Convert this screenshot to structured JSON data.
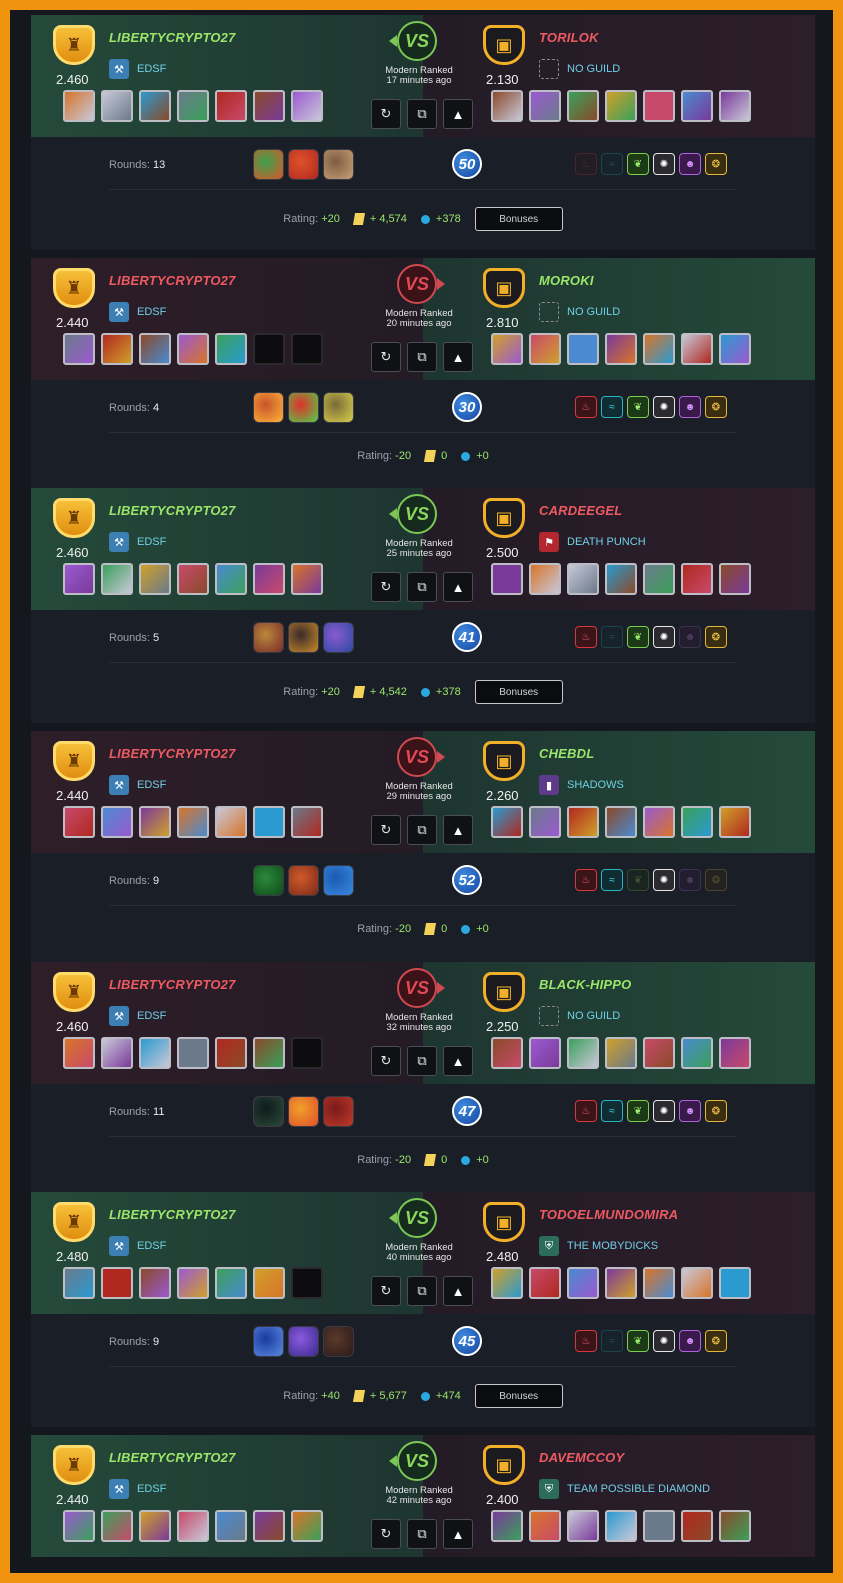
{
  "battles": [
    {
      "result": "win",
      "left": {
        "name": "LIBERTYCRYPTO27",
        "rating": "2.460",
        "guild": "EDSF",
        "guild_icon": "blue",
        "name_class": "win",
        "cards": 7,
        "empty": 0
      },
      "right": {
        "name": "TORILOK",
        "rating": "2.130",
        "guild": "NO GUILD",
        "guild_icon": "none",
        "name_class": "loss",
        "cards": 7,
        "empty": 0
      },
      "mode": "Modern Ranked",
      "time": "17 minutes ago",
      "rounds_label": "Rounds:",
      "rounds": "13",
      "mana": "50",
      "splinters": [
        false,
        false,
        true,
        true,
        true,
        true
      ],
      "rating_label": "Rating:",
      "rating_change": "+20",
      "dec": "+ 4,574",
      "sps": "+378",
      "bonuses": "Bonuses"
    },
    {
      "result": "loss",
      "left": {
        "name": "LIBERTYCRYPTO27",
        "rating": "2.440",
        "guild": "EDSF",
        "guild_icon": "blue",
        "name_class": "loss",
        "cards": 5,
        "empty": 2
      },
      "right": {
        "name": "MOROKI",
        "rating": "2.810",
        "guild": "NO GUILD",
        "guild_icon": "none",
        "name_class": "win",
        "cards": 7,
        "empty": 0
      },
      "mode": "Modern Ranked",
      "time": "20 minutes ago",
      "rounds_label": "Rounds:",
      "rounds": "4",
      "mana": "30",
      "splinters": [
        true,
        true,
        true,
        true,
        true,
        true
      ],
      "rating_label": "Rating:",
      "rating_change": "-20",
      "dec": "0",
      "sps": "+0",
      "bonuses": ""
    },
    {
      "result": "win",
      "left": {
        "name": "LIBERTYCRYPTO27",
        "rating": "2.460",
        "guild": "EDSF",
        "guild_icon": "blue",
        "name_class": "win",
        "cards": 7,
        "empty": 0
      },
      "right": {
        "name": "CARDEEGEL",
        "rating": "2.500",
        "guild": "DEATH PUNCH",
        "guild_icon": "red",
        "name_class": "loss",
        "cards": 7,
        "empty": 0
      },
      "mode": "Modern Ranked",
      "time": "25 minutes ago",
      "rounds_label": "Rounds:",
      "rounds": "5",
      "mana": "41",
      "splinters": [
        true,
        false,
        true,
        true,
        false,
        true
      ],
      "rating_label": "Rating:",
      "rating_change": "+20",
      "dec": "+ 4,542",
      "sps": "+378",
      "bonuses": "Bonuses"
    },
    {
      "result": "loss",
      "left": {
        "name": "LIBERTYCRYPTO27",
        "rating": "2.440",
        "guild": "EDSF",
        "guild_icon": "blue",
        "name_class": "loss",
        "cards": 7,
        "empty": 0
      },
      "right": {
        "name": "CHEBDL",
        "rating": "2.260",
        "guild": "SHADOWS",
        "guild_icon": "purple",
        "name_class": "win",
        "cards": 7,
        "empty": 0
      },
      "mode": "Modern Ranked",
      "time": "29 minutes ago",
      "rounds_label": "Rounds:",
      "rounds": "9",
      "mana": "52",
      "splinters": [
        true,
        true,
        false,
        true,
        false,
        false
      ],
      "rating_label": "Rating:",
      "rating_change": "-20",
      "dec": "0",
      "sps": "+0",
      "bonuses": ""
    },
    {
      "result": "loss",
      "left": {
        "name": "LIBERTYCRYPTO27",
        "rating": "2.460",
        "guild": "EDSF",
        "guild_icon": "blue",
        "name_class": "loss",
        "cards": 6,
        "empty": 1
      },
      "right": {
        "name": "BLACK-HIPPO",
        "rating": "2.250",
        "guild": "NO GUILD",
        "guild_icon": "none",
        "name_class": "win",
        "cards": 7,
        "empty": 0
      },
      "mode": "Modern Ranked",
      "time": "32 minutes ago",
      "rounds_label": "Rounds:",
      "rounds": "11",
      "mana": "47",
      "splinters": [
        true,
        true,
        true,
        true,
        true,
        true
      ],
      "rating_label": "Rating:",
      "rating_change": "-20",
      "dec": "0",
      "sps": "+0",
      "bonuses": ""
    },
    {
      "result": "win",
      "left": {
        "name": "LIBERTYCRYPTO27",
        "rating": "2.480",
        "guild": "EDSF",
        "guild_icon": "blue",
        "name_class": "win",
        "cards": 6,
        "empty": 1
      },
      "right": {
        "name": "TODOELMUNDOMIRA",
        "rating": "2.480",
        "guild": "THE MOBYDICKS",
        "guild_icon": "green",
        "name_class": "loss",
        "cards": 7,
        "empty": 0
      },
      "mode": "Modern Ranked",
      "time": "40 minutes ago",
      "rounds_label": "Rounds:",
      "rounds": "9",
      "mana": "45",
      "splinters": [
        true,
        false,
        true,
        true,
        true,
        true
      ],
      "rating_label": "Rating:",
      "rating_change": "+40",
      "dec": "+ 5,677",
      "sps": "+474",
      "bonuses": "Bonuses"
    },
    {
      "result": "win",
      "left": {
        "name": "LIBERTYCRYPTO27",
        "rating": "2.440",
        "guild": "EDSF",
        "guild_icon": "blue",
        "name_class": "win",
        "cards": 7,
        "empty": 0
      },
      "right": {
        "name": "DAVEMCCOY",
        "rating": "2.400",
        "guild": "TEAM POSSIBLE DIAMOND",
        "guild_icon": "green",
        "name_class": "loss",
        "cards": 7,
        "empty": 0
      },
      "mode": "Modern Ranked",
      "time": "42 minutes ago",
      "rounds_label": "",
      "rounds": "",
      "mana": "",
      "splinters": [],
      "rating_label": "",
      "rating_change": "",
      "dec": "",
      "sps": "",
      "bonuses": ""
    }
  ],
  "icons": {
    "replay": "↻",
    "copy": "⧉",
    "expand": "▲"
  },
  "splinter_glyphs": [
    "🔥",
    "🌊",
    "🍃",
    "✦",
    "☠",
    "🐉"
  ]
}
